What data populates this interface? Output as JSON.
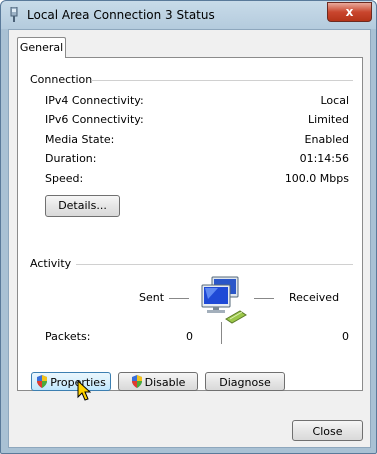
{
  "window": {
    "title": "Local Area Connection 3 Status",
    "close_glyph": "x"
  },
  "tabs": [
    {
      "label": "General"
    }
  ],
  "connection": {
    "header": "Connection",
    "rows": [
      {
        "label": "IPv4 Connectivity:",
        "value": "Local"
      },
      {
        "label": "IPv6 Connectivity:",
        "value": "Limited"
      },
      {
        "label": "Media State:",
        "value": "Enabled"
      },
      {
        "label": "Duration:",
        "value": "01:14:56"
      },
      {
        "label": "Speed:",
        "value": "100.0 Mbps"
      }
    ],
    "details_button": "Details..."
  },
  "activity": {
    "header": "Activity",
    "sent_label": "Sent",
    "received_label": "Received",
    "packets_label": "Packets:",
    "packets_sent": "0",
    "packets_received": "0"
  },
  "buttons": {
    "properties": "Properties",
    "disable": "Disable",
    "diagnose": "Diagnose",
    "close": "Close"
  },
  "icons": [
    "network-connection-icon",
    "shield-icon",
    "network-computers-icon",
    "cursor-icon"
  ]
}
